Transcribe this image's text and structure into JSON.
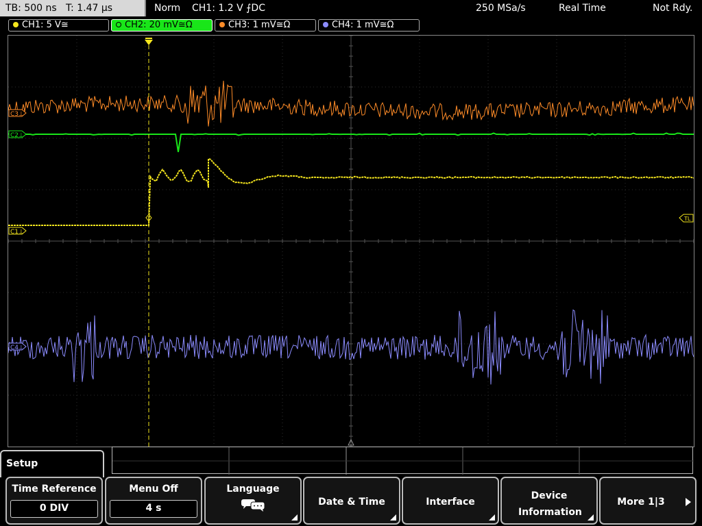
{
  "status": {
    "timebase": "TB: 500 ns",
    "trigger_time": "T: 1.47 µs",
    "mode": "Norm",
    "trigger_info": "CH1: 1.2 V ⨍DC",
    "sample_rate": "250 MSa/s",
    "acq_mode": "Real Time",
    "state": "Not Rdy."
  },
  "channels": [
    {
      "label": "CH1: 5 V≅",
      "color": "#f5e61e"
    },
    {
      "label": "CH2: 20 mV≅Ω",
      "color": "#19e619"
    },
    {
      "label": "CH3: 1 mV≅Ω",
      "color": "#ff8c28"
    },
    {
      "label": "CH4: 1 mV≅Ω",
      "color": "#8c8cff"
    }
  ],
  "markers": {
    "c1": "C1⊥",
    "c2": "C2⊥",
    "c3": "C3⊥",
    "c4": "C4⊥",
    "trigger_level": "TL"
  },
  "menu": {
    "title": "Setup",
    "softkeys": [
      {
        "label": "Time Reference",
        "value": "0 DIV"
      },
      {
        "label": "Menu Off",
        "value": "4 s"
      },
      {
        "label": "Language",
        "icon": "speech-bubbles-icon"
      },
      {
        "label": "Date & Time"
      },
      {
        "label": "Interface"
      },
      {
        "label": "Device Information"
      },
      {
        "label": "More 1|3"
      }
    ]
  }
}
